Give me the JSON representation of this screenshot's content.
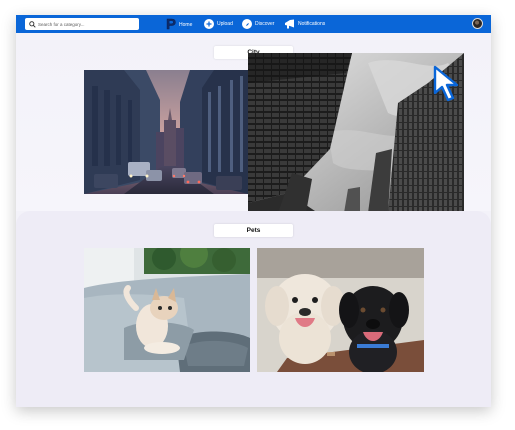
{
  "topbar": {
    "search_placeholder": "Search for a category...",
    "brand_label": "Home",
    "brand_logo_letter": "P",
    "nav": [
      {
        "label": "Upload",
        "icon": "plus-icon"
      },
      {
        "label": "Discover",
        "icon": "compass-icon"
      },
      {
        "label": "Notifications",
        "icon": "megaphone-icon"
      }
    ],
    "accent_color": "#0a66d8"
  },
  "sections": [
    {
      "title": "City",
      "images": [
        "city-street-image",
        "skyscrapers-image"
      ]
    },
    {
      "title": "Pets",
      "images": [
        "kitten-on-sofa-image",
        "two-dogs-image"
      ]
    }
  ]
}
